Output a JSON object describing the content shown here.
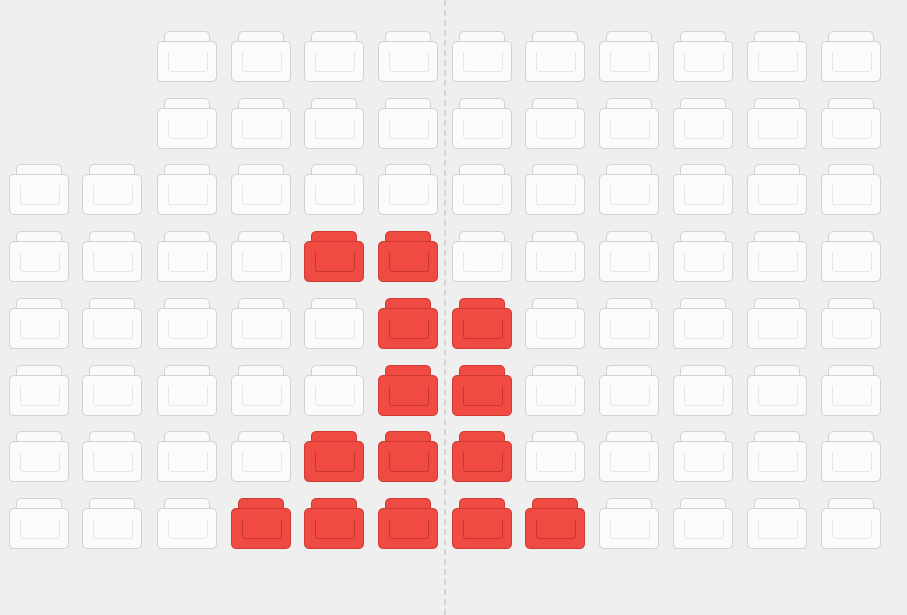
{
  "colors": {
    "background": "#efefef",
    "seat_available": "#fafafa",
    "seat_border": "#d2d2d2",
    "seat_taken": "#ef4b42",
    "aisle_line": "#d4d4d4"
  },
  "icons": {
    "seat": "seat-icon",
    "aisle": "aisle-divider"
  },
  "seat_map": {
    "columns": 12,
    "rows": [
      {
        "seats": [
          null,
          null,
          "a",
          "a",
          "a",
          "a",
          "a",
          "a",
          "a",
          "a",
          "a",
          "a"
        ]
      },
      {
        "seats": [
          null,
          null,
          "a",
          "a",
          "a",
          "a",
          "a",
          "a",
          "a",
          "a",
          "a",
          "a"
        ]
      },
      {
        "seats": [
          "a",
          "a",
          "a",
          "a",
          "a",
          "a",
          "a",
          "a",
          "a",
          "a",
          "a",
          "a"
        ]
      },
      {
        "seats": [
          "a",
          "a",
          "a",
          "a",
          "t",
          "t",
          "a",
          "a",
          "a",
          "a",
          "a",
          "a"
        ]
      },
      {
        "seats": [
          "a",
          "a",
          "a",
          "a",
          "a",
          "t",
          "t",
          "a",
          "a",
          "a",
          "a",
          "a"
        ]
      },
      {
        "seats": [
          "a",
          "a",
          "a",
          "a",
          "a",
          "t",
          "t",
          "a",
          "a",
          "a",
          "a",
          "a"
        ]
      },
      {
        "seats": [
          "a",
          "a",
          "a",
          "a",
          "t",
          "t",
          "t",
          "a",
          "a",
          "a",
          "a",
          "a"
        ]
      },
      {
        "seats": [
          "a",
          "a",
          "a",
          "t",
          "t",
          "t",
          "t",
          "t",
          "a",
          "a",
          "a",
          "a"
        ]
      }
    ]
  }
}
